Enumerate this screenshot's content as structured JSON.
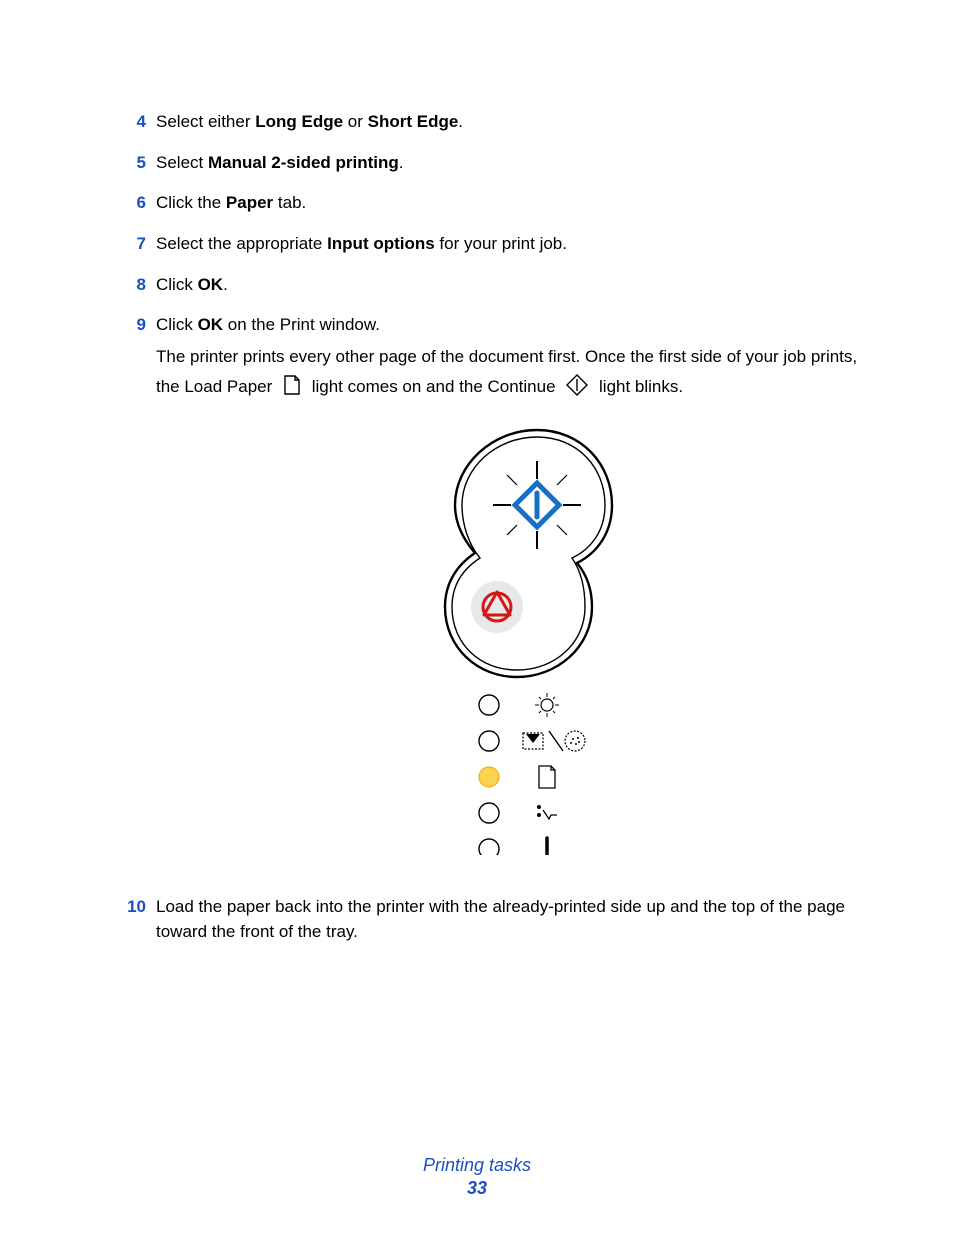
{
  "steps": [
    {
      "n": "4",
      "parts": [
        "Select either ",
        {
          "b": "Long Edge"
        },
        " or ",
        {
          "b": "Short Edge"
        },
        "."
      ]
    },
    {
      "n": "5",
      "parts": [
        "Select ",
        {
          "b": "Manual 2-sided printing"
        },
        "."
      ]
    },
    {
      "n": "6",
      "parts": [
        "Click the ",
        {
          "b": "Paper"
        },
        " tab."
      ]
    },
    {
      "n": "7",
      "parts": [
        "Select the appropriate ",
        {
          "b": "Input options"
        },
        " for your print job."
      ]
    },
    {
      "n": "8",
      "parts": [
        "Click ",
        {
          "b": "OK"
        },
        "."
      ]
    },
    {
      "n": "9",
      "parts": [
        "Click ",
        {
          "b": "OK"
        },
        " on the Print window."
      ]
    }
  ],
  "note_before_icon1": "The printer prints every other page of the document first. Once the first side of your job prints, the Load Paper ",
  "note_mid": " light comes on and the Continue ",
  "note_after": " light blinks.",
  "step10": {
    "n": "10",
    "text": "Load the paper back into the printer with the already-printed side up and the top of the page toward the front of the tray."
  },
  "footer": {
    "title": "Printing tasks",
    "page": "33"
  }
}
